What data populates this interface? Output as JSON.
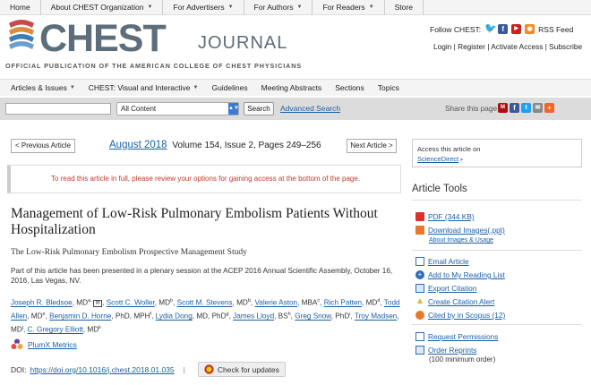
{
  "topnav": {
    "items": [
      {
        "label": "Home",
        "dropdown": false
      },
      {
        "label": "About CHEST Organization",
        "dropdown": true
      },
      {
        "label": "For Advertisers",
        "dropdown": true
      },
      {
        "label": "For Authors",
        "dropdown": true
      },
      {
        "label": "For Readers",
        "dropdown": true
      },
      {
        "label": "Store",
        "dropdown": false
      }
    ]
  },
  "header": {
    "brand": "CHEST",
    "journal": "JOURNAL",
    "tagline": "OFFICIAL PUBLICATION OF THE AMERICAN COLLEGE OF CHEST PHYSICIANS",
    "follow_label": "Follow CHEST:",
    "rss_label": "RSS Feed",
    "account_links": [
      "Login",
      "Register",
      "Activate Access",
      "Subscribe"
    ]
  },
  "secnav": {
    "items": [
      {
        "label": "Articles & Issues",
        "dropdown": true
      },
      {
        "label": "CHEST: Visual and Interactive",
        "dropdown": true
      },
      {
        "label": "Guidelines",
        "dropdown": false
      },
      {
        "label": "Meeting Abstracts",
        "dropdown": false
      },
      {
        "label": "Sections",
        "dropdown": false
      },
      {
        "label": "Topics",
        "dropdown": false
      }
    ]
  },
  "search": {
    "value": "",
    "scope": "All Content",
    "button": "Search",
    "advanced": "Advanced Search",
    "share_label": "Share this page"
  },
  "article": {
    "prev": "< Previous Article",
    "next": "Next Article >",
    "issue_date": "August 2018",
    "issue_details": "Volume 154, Issue 2, Pages 249–256",
    "access_notice": "To read this article in full, please review your options for gaining access at the bottom of the page.",
    "title": "Management of Low-Risk Pulmonary Embolism Patients Without Hospitalization",
    "subtitle": "The Low-Risk Pulmonary Embolism Prospective Management Study",
    "note": "Part of this article has been presented in a plenary session at the ACEP 2016 Annual Scientific Assembly, October 16, 2016, Las Vegas, NV.",
    "authors": [
      {
        "name": "Joseph R. Bledsoe",
        "suffix": ", MD",
        "sup": "a, ",
        "mail": true
      },
      {
        "name": "Scott C. Woller",
        "suffix": ", MD",
        "sup": "b"
      },
      {
        "name": "Scott M. Stevens",
        "suffix": ", MD",
        "sup": "b"
      },
      {
        "name": "Valerie Aston",
        "suffix": ", MBA",
        "sup": "c"
      },
      {
        "name": "Rich Patten",
        "suffix": ", MD",
        "sup": "d"
      },
      {
        "name": "Todd Allen",
        "suffix": ", MD",
        "sup": "e"
      },
      {
        "name": "Benjamin D. Horne",
        "suffix": ", PhD, MPH",
        "sup": "f"
      },
      {
        "name": "Lydia Dong",
        "suffix": ", MD, PhD",
        "sup": "g"
      },
      {
        "name": "James Lloyd",
        "suffix": ", BS",
        "sup": "h"
      },
      {
        "name": "Greg Snow",
        "suffix": ", PhD",
        "sup": "i"
      },
      {
        "name": "Troy Madsen",
        "suffix": ", MD",
        "sup": "j"
      },
      {
        "name": "C. Gregory Elliott",
        "suffix": ", MD",
        "sup": "k"
      }
    ],
    "plumx": "PlumX Metrics",
    "doi_label": "DOI:",
    "doi": "https://doi.org/10.1016/j.chest.2018.01.035",
    "check_updates": "Check for updates"
  },
  "sidebar": {
    "access_text": "Access this article on",
    "access_link": "ScienceDirect",
    "tools_title": "Article Tools",
    "tools": [
      {
        "label": "PDF (344 KB)",
        "icon": "pdf-icon",
        "color": "#d9342b"
      },
      {
        "label": "Download Images(.ppt)",
        "icon": "ppt-icon",
        "color": "#e8792c"
      },
      {
        "label": "Email Article",
        "icon": "email-icon",
        "color": "#2f6db5"
      },
      {
        "label": "Add to My Reading List",
        "icon": "reading-list-icon",
        "color": "#2f6db5"
      },
      {
        "label": "Export Citation",
        "icon": "export-icon",
        "color": "#2f6db5"
      },
      {
        "label": "Create Citation Alert",
        "icon": "alert-icon",
        "color": "#2f6db5"
      },
      {
        "label": "Cited by in Scopus (12)",
        "icon": "scopus-icon",
        "color": "#e8792c"
      },
      {
        "label": "Request Permissions",
        "icon": "permissions-icon",
        "color": "#2f6db5"
      },
      {
        "label": "Order Reprints",
        "icon": "reprints-icon",
        "color": "#2f6db5"
      }
    ],
    "ppt_sub": "About Images & Usage",
    "reprints_sub": "(100 minimum order)"
  }
}
